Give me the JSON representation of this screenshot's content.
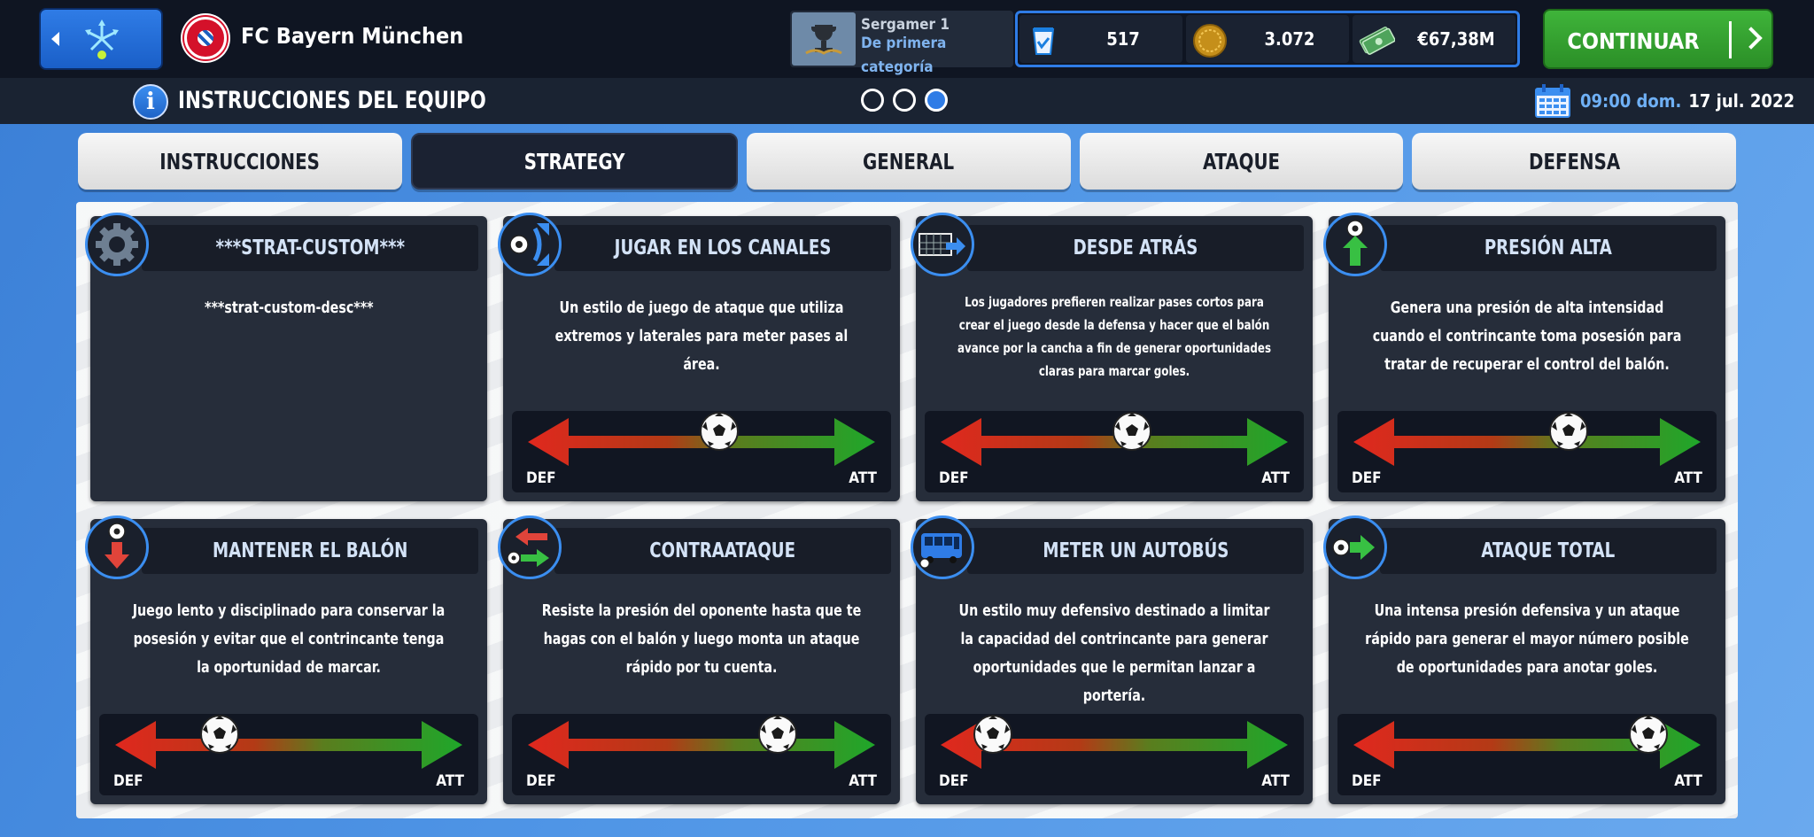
{
  "header": {
    "club_name": "FC Bayern München",
    "manager_name": "Sergamer 1",
    "manager_division": "De primera categoría",
    "currencies": [
      {
        "icon": "credits-icon",
        "value": "517"
      },
      {
        "icon": "coin-icon",
        "value": "3.072"
      },
      {
        "icon": "cash-icon",
        "value": "€67,38M"
      }
    ],
    "continue_label": "CONTINUAR"
  },
  "subheader": {
    "title": "INSTRUCCIONES DEL EQUIPO",
    "time": "09:00 dom.",
    "date": "17 jul. 2022",
    "page_dots": {
      "count": 3,
      "active": 3
    }
  },
  "tabs": [
    {
      "label": "INSTRUCCIONES",
      "active": false
    },
    {
      "label": "STRATEGY",
      "active": true
    },
    {
      "label": "GENERAL",
      "active": false
    },
    {
      "label": "ATAQUE",
      "active": false
    },
    {
      "label": "DEFENSA",
      "active": false
    }
  ],
  "slider_labels": {
    "def": "DEF",
    "att": "ATT"
  },
  "strategies": [
    {
      "name": "strat-custom",
      "title": "***STRAT-CUSTOM***",
      "description": "***strat-custom-desc***",
      "icon": "gear-icon",
      "slider": null
    },
    {
      "name": "jugar-en-los-canales",
      "title": "JUGAR EN LOS CANALES",
      "description": "Un estilo de juego de ataque que utiliza extremos y laterales para meter pases al área.",
      "icon": "channels-icon",
      "slider": 0.55
    },
    {
      "name": "desde-atras",
      "title": "DESDE ATRÁS",
      "description": "Los jugadores prefieren realizar pases cortos para crear el juego desde la defensa y hacer que el balón avance por la cancha a fin de generar oportunidades claras para marcar goles.",
      "icon": "goal-icon",
      "slider": 0.55
    },
    {
      "name": "presion-alta",
      "title": "PRESIÓN ALTA",
      "description": "Genera una presión de alta intensidad cuando el contrincante toma posesión para tratar de recuperar el control del balón.",
      "icon": "press-up-icon",
      "slider": 0.62
    },
    {
      "name": "mantener-el-balon",
      "title": "MANTENER EL BALÓN",
      "description": "Juego lento y disciplinado para conservar la posesión y evitar que el contrincante tenga la oportunidad de marcar.",
      "icon": "hold-down-icon",
      "slider": 0.3
    },
    {
      "name": "contraataque",
      "title": "CONTRAATAQUE",
      "description": "Resiste la presión del oponente hasta que te hagas con el balón y luego monta un ataque rápido por tu cuenta.",
      "icon": "counter-icon",
      "slider": 0.72
    },
    {
      "name": "meter-un-autobus",
      "title": "METER UN AUTOBÚS",
      "description": "Un estilo muy defensivo destinado a limitar la capacidad del contrincante para generar oportunidades que le permitan lanzar a portería.",
      "icon": "bus-icon",
      "slider": 0.15
    },
    {
      "name": "ataque-total",
      "title": "ATAQUE TOTAL",
      "description": "Una intensa presión defensiva y un ataque rápido para generar el mayor número posible de oportunidades para anotar goles.",
      "icon": "attack-right-icon",
      "slider": 0.85
    }
  ]
}
